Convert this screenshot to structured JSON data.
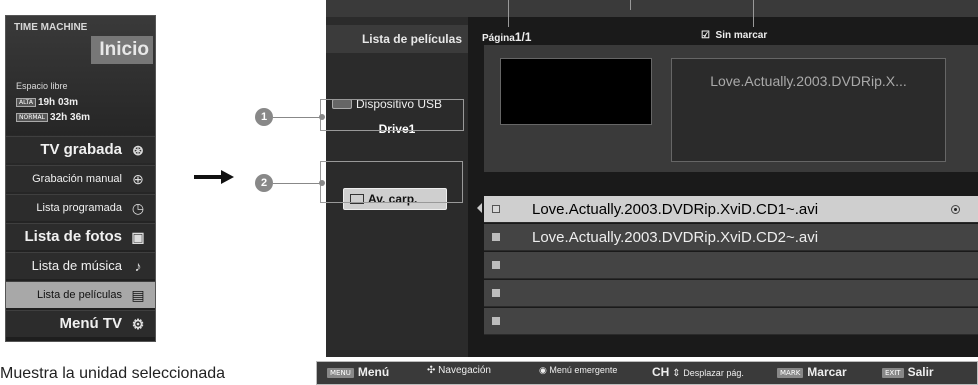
{
  "time_machine": {
    "title": "TIME MACHINE",
    "home_label": "Inicio",
    "free_space_label": "Espacio libre",
    "quality_high_badge": "ALTA",
    "quality_high_time": "19h 03m",
    "quality_normal_badge": "NORMAL",
    "quality_normal_time": "32h 36m",
    "items": [
      {
        "label": "TV grabada",
        "icon": "tv-recorded-icon",
        "selected": false
      },
      {
        "label": "Grabación manual",
        "icon": "manual-record-icon",
        "selected": false
      },
      {
        "label": "Lista programada",
        "icon": "schedule-icon",
        "selected": false
      },
      {
        "label": "Lista de fotos",
        "icon": "photo-icon",
        "selected": false
      },
      {
        "label": "Lista de música",
        "icon": "music-note-icon",
        "selected": false
      },
      {
        "label": "Lista de películas",
        "icon": "movie-icon",
        "selected": true
      },
      {
        "label": "Menú TV",
        "icon": "gear-icon",
        "selected": false
      }
    ]
  },
  "callouts": {
    "one": "1",
    "two": "2"
  },
  "movie_screen": {
    "sidebar_header": "Lista de películas",
    "usb_label": "Dispositivo USB",
    "drive_label": "Drive1",
    "folder_button": "Av. carp.",
    "page_label": "Página",
    "page_value": "1/1",
    "unmark_label": "Sin marcar",
    "preview_filename": "Love.Actually.2003.DVDRip.X...",
    "files": [
      {
        "name": "Love.Actually.2003.DVDRip.XviD.CD1~.avi",
        "highlighted": true
      },
      {
        "name": "Love.Actually.2003.DVDRip.XviD.CD2~.avi",
        "highlighted": false
      },
      {
        "name": "",
        "highlighted": false
      },
      {
        "name": "",
        "highlighted": false
      },
      {
        "name": "",
        "highlighted": false
      }
    ]
  },
  "bottom_bar": {
    "menu_key": "MENU",
    "menu_label": "Menú",
    "nav_label": "Navegación",
    "popup_label": "Menú emergente",
    "ch_key": "CH",
    "page_scroll_label": "Desplazar pág.",
    "mark_key": "MARK",
    "mark_label": "Marcar",
    "exit_key": "EXIT",
    "exit_label": "Salir"
  },
  "caption": "Muestra la unidad seleccionada"
}
